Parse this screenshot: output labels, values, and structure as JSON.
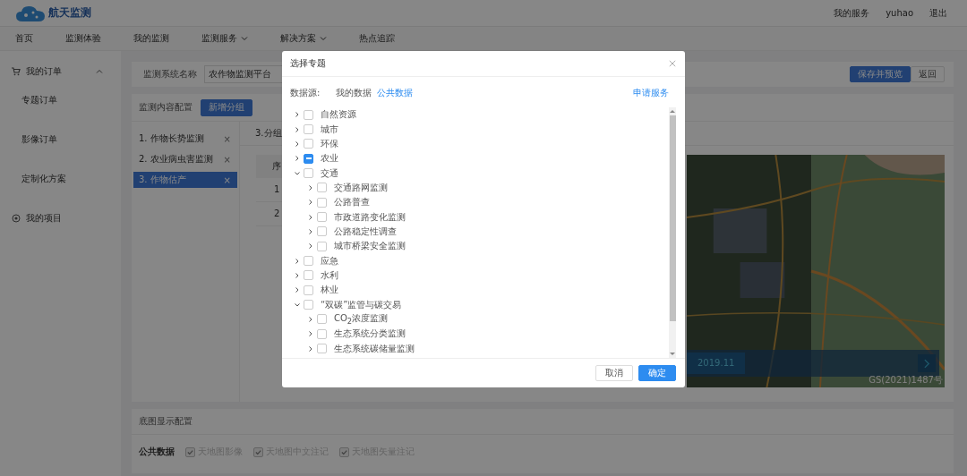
{
  "header": {
    "brand": "航天监测",
    "links": [
      "我的服务",
      "yuhao",
      "退出"
    ]
  },
  "nav": [
    {
      "label": "首页",
      "dropdown": false
    },
    {
      "label": "监测体验",
      "dropdown": false
    },
    {
      "label": "我的监测",
      "dropdown": false
    },
    {
      "label": "监测服务",
      "dropdown": true
    },
    {
      "label": "解决方案",
      "dropdown": true
    },
    {
      "label": "热点追踪",
      "dropdown": false
    }
  ],
  "sidebar": {
    "groups": [
      {
        "label": "我的订单",
        "expanded": true,
        "items": [
          "专题订单",
          "影像订单",
          "定制化方案"
        ]
      },
      {
        "label": "我的项目"
      }
    ]
  },
  "system": {
    "label": "监测系统名称",
    "value": "农作物监测平台",
    "buttons": [
      {
        "label": "保存并预览",
        "primary": true
      },
      {
        "label": "返回",
        "primary": false
      }
    ]
  },
  "content_config": {
    "title": "监测内容配置",
    "add_button": "新增分组",
    "groups": [
      {
        "label": "1. 作物长势监测",
        "remove": "×",
        "selected": false
      },
      {
        "label": "2. 农业病虫害监测",
        "remove": "×",
        "selected": false
      },
      {
        "label": "3. 作物估产",
        "remove": "×",
        "selected": true
      }
    ],
    "group_name": "3.分组",
    "table": {
      "columns": [
        "序"
      ],
      "rows": [
        [
          "1"
        ],
        [
          "2"
        ]
      ]
    },
    "map": {
      "kind": "picture",
      "date": "2019.11",
      "credit": "GS(2021)1487号"
    }
  },
  "basemap": {
    "title": "底图显示配置",
    "label": "公共数据",
    "options": [
      {
        "label": "天地图影像",
        "checked": true
      },
      {
        "label": "天地图中文注记",
        "checked": true
      },
      {
        "label": "天地图矢量注记",
        "checked": true
      }
    ]
  },
  "dialog": {
    "title": "选择专题",
    "source_label": "数据源:",
    "sources": [
      {
        "label": "我的数据",
        "selected": false
      },
      {
        "label": "公共数据",
        "selected": true
      }
    ],
    "apply_link": "申请服务",
    "tree": [
      {
        "label": "自然资源",
        "indeterminate": false,
        "expanded": false
      },
      {
        "label": "城市",
        "indeterminate": false,
        "expanded": false
      },
      {
        "label": "环保",
        "indeterminate": false,
        "expanded": false
      },
      {
        "label": "农业",
        "indeterminate": true,
        "expanded": false
      },
      {
        "label": "交通",
        "indeterminate": false,
        "expanded": true,
        "children": [
          {
            "label": "交通路网监测",
            "indeterminate": false,
            "expanded": false
          },
          {
            "label": "公路普查",
            "indeterminate": false,
            "expanded": false
          },
          {
            "label": "市政道路变化监测",
            "indeterminate": false,
            "expanded": false
          },
          {
            "label": "公路稳定性调查",
            "indeterminate": false,
            "expanded": false
          },
          {
            "label": "城市桥梁安全监测",
            "indeterminate": false,
            "expanded": false
          }
        ]
      },
      {
        "label": "应急",
        "indeterminate": false,
        "expanded": false
      },
      {
        "label": "水利",
        "indeterminate": false,
        "expanded": false
      },
      {
        "label": "林业",
        "indeterminate": false,
        "expanded": false
      },
      {
        "label": "“双碳”监管与碳交易",
        "indeterminate": false,
        "expanded": true,
        "children": [
          {
            "label": "CO$_{2}$浓度监测",
            "indeterminate": false,
            "expanded": false
          },
          {
            "label": "生态系统分类监测",
            "indeterminate": false,
            "expanded": false
          },
          {
            "label": "生态系统碳储量监测",
            "indeterminate": false,
            "expanded": false
          }
        ]
      }
    ],
    "buttons": [
      {
        "label": "取消",
        "primary": false
      },
      {
        "label": "确定",
        "primary": true
      }
    ]
  }
}
